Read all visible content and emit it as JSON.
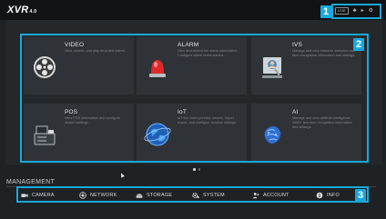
{
  "app": {
    "logo": "XVR",
    "version": "4.0"
  },
  "topbar": {
    "badge_label": "LIVE",
    "tools": [
      {
        "name": "user-icon",
        "glyph": "♣"
      },
      {
        "name": "playback-icon",
        "glyph": "▸"
      },
      {
        "name": "settings-icon",
        "glyph": "⚙"
      }
    ]
  },
  "callouts": [
    "1",
    "2",
    "3"
  ],
  "accent_color": "#18a9dc",
  "tiles": [
    {
      "title": "VIDEO",
      "desc": "View, search, and play recorded videos.",
      "icon": "film-reel-icon"
    },
    {
      "title": "ALARM",
      "desc": "View and search the alarm information. Configure alarm event actions.",
      "icon": "alarm-light-icon"
    },
    {
      "title": "IVS",
      "desc": "Manage and view intrusion detection and face recognition information and settings.",
      "icon": "ivs-analytics-icon"
    },
    {
      "title": "POS",
      "desc": "View POS information and configure related settings.",
      "icon": "pos-terminal-icon"
    },
    {
      "title": "IoT",
      "desc": "IoT live video preview, search, report export, and configure function settings.",
      "icon": "iot-globe-icon"
    },
    {
      "title": "AI",
      "desc": "Manage and view artificial intelligence SMD+ and face recognition information and settings.",
      "icon": "ai-brain-icon"
    }
  ],
  "pager": {
    "pages": 2,
    "current": 1
  },
  "management": {
    "title": "MANAGEMENT",
    "items": [
      {
        "label": "CAMERA",
        "icon": "camera-icon"
      },
      {
        "label": "NETWORK",
        "icon": "network-icon"
      },
      {
        "label": "STORAGE",
        "icon": "storage-icon"
      },
      {
        "label": "SYSTEM",
        "icon": "system-gear-icon"
      },
      {
        "label": "ACCOUNT",
        "icon": "account-icon"
      },
      {
        "label": "INFO",
        "icon": "info-icon"
      }
    ]
  }
}
